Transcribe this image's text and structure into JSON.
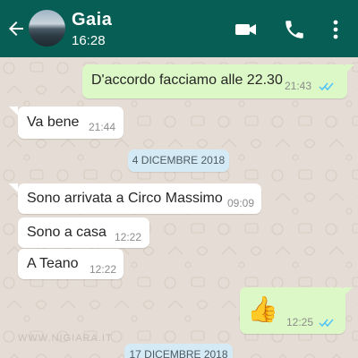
{
  "header": {
    "contact_name": "Gaia",
    "status_text": "16:28",
    "icons": [
      "back-arrow-icon",
      "video-call-icon",
      "phone-call-icon",
      "more-options-icon"
    ]
  },
  "messages": [
    {
      "direction": "out",
      "text": "D'accordo facciamo alle 22.30",
      "time": "21:43",
      "read": true
    },
    {
      "direction": "in",
      "text": "Va bene",
      "time": "21:44"
    },
    {
      "type": "date",
      "text": "4 DICEMBRE 2018"
    },
    {
      "direction": "in",
      "text": "Sono arrivata a Circo Massimo",
      "time": "09:09"
    },
    {
      "direction": "in",
      "text": "Sono a casa",
      "time": "12:22"
    },
    {
      "direction": "in",
      "text": "A Teano",
      "time": "12:22"
    },
    {
      "direction": "out",
      "text": "👍",
      "time": "12:25",
      "read": true
    },
    {
      "type": "date",
      "text": "17 DICEMBRE 2018"
    }
  ],
  "watermark": "WWW.NIGIARA.IT",
  "colors": {
    "header": "#075e54",
    "outgoing_bubble": "#dcf8c6",
    "incoming_bubble": "#ffffff",
    "read_ticks": "#4fc3f7",
    "date_chip": "#d4eaf4",
    "wallpaper": "#e5ddd5"
  }
}
